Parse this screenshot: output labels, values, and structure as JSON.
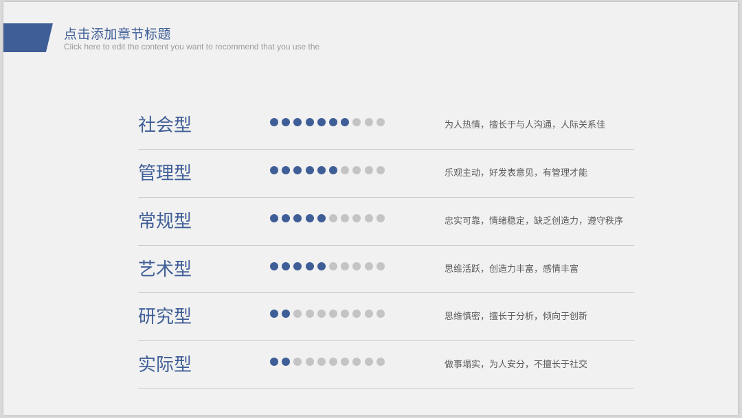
{
  "header": {
    "title": "点击添加章节标题",
    "subtitle": "Click here to edit the content you want to recommend that you use the"
  },
  "colors": {
    "accent": "#3f5e97",
    "dot_inactive": "#c4c4c4",
    "background": "#f1f1f1"
  },
  "rating_scale_max": 10,
  "rows": [
    {
      "name": "社会型",
      "rating": 7,
      "description": "为人热情，擅长于与人沟通，人际关系佳"
    },
    {
      "name": "管理型",
      "rating": 6,
      "description": "乐观主动，好发表意见，有管理才能"
    },
    {
      "name": "常规型",
      "rating": 5,
      "description": "忠实可靠，情绪稳定，缺乏创造力，遵守秩序"
    },
    {
      "name": "艺术型",
      "rating": 5,
      "description": "思维活跃，创造力丰富，感情丰富"
    },
    {
      "name": "研究型",
      "rating": 2,
      "description": "思维慎密，擅长于分析，倾向于创新"
    },
    {
      "name": "实际型",
      "rating": 2,
      "description": "做事塌实，为人安分，不擅长于社交"
    }
  ]
}
